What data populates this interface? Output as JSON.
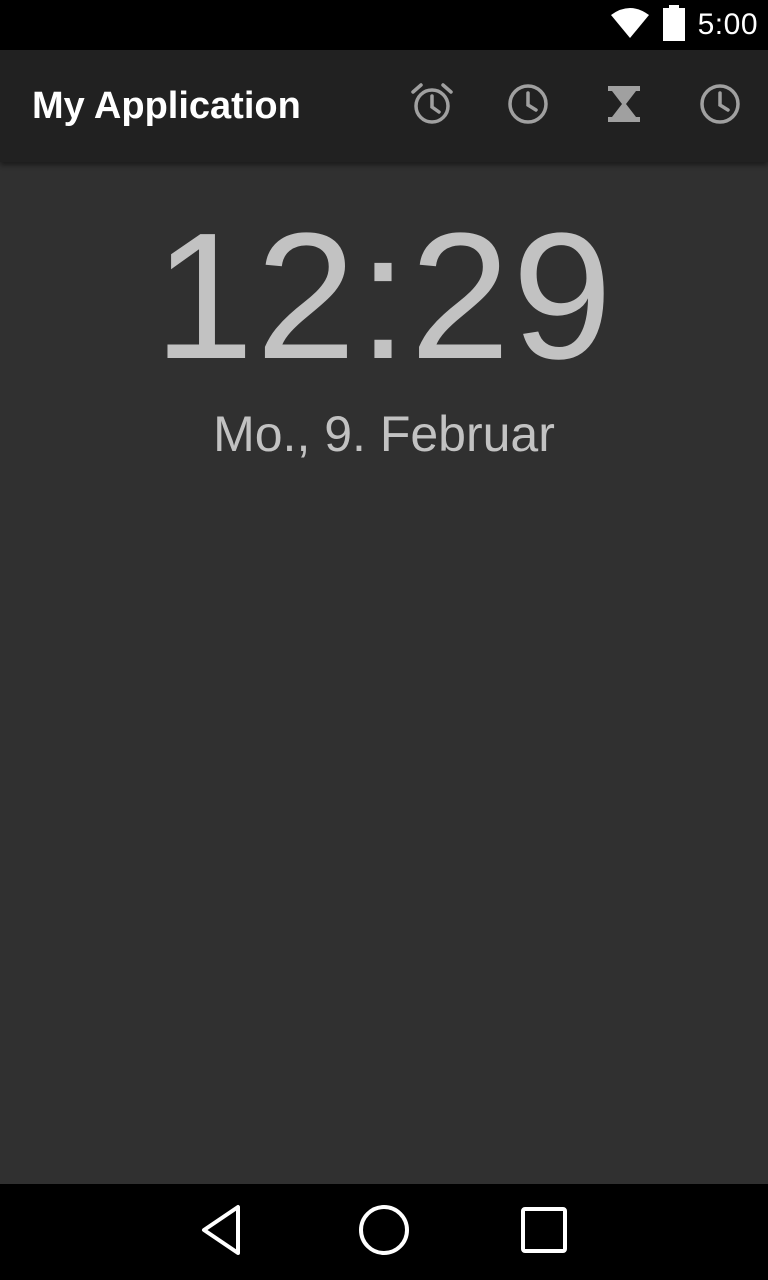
{
  "status_bar": {
    "time": "5:00",
    "icons": [
      "wifi-icon",
      "battery-icon"
    ]
  },
  "app_bar": {
    "title": "My Application",
    "actions": [
      {
        "icon": "alarm-icon"
      },
      {
        "icon": "clock-icon"
      },
      {
        "icon": "hourglass-icon"
      },
      {
        "icon": "clock-icon"
      }
    ]
  },
  "clock": {
    "time": "12:29",
    "date": "Mo., 9. Februar"
  },
  "nav_bar": {
    "buttons": [
      "back-icon",
      "home-icon",
      "recents-icon"
    ]
  },
  "colors": {
    "background": "#303030",
    "app_bar": "#212121",
    "clock_text": "#c2c2c2",
    "icon_gray": "#a0a0a0"
  }
}
